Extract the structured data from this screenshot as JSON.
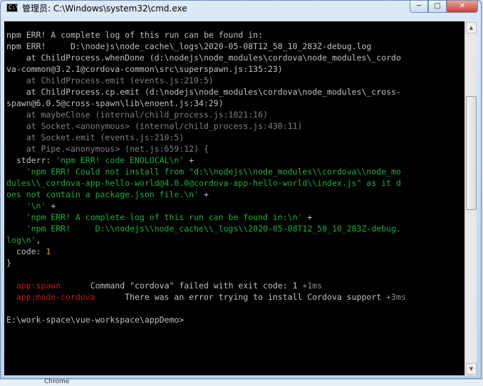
{
  "window": {
    "icon_text": "C:\\",
    "title": "管理员: C:\\Windows\\system32\\cmd.exe",
    "min_label": "─",
    "max_label": "□",
    "close_label": "✕"
  },
  "console": {
    "lines": [
      [
        {
          "t": "npm ERR! A complete log of this run can be found in:"
        }
      ],
      [
        {
          "t": "npm ERR!     D:\\nodejs\\node_cache\\_logs\\2020-05-08T12_58_10_283Z-debug.log"
        }
      ],
      [
        {
          "t": "    at ChildProcess.whenDone (d:\\nodejs\\node_modules\\cordova\\node_modules\\_cordo"
        }
      ],
      [
        {
          "t": "va-common@3.2.1@cordova-common\\src\\superspawn.js:135:23)"
        }
      ],
      [
        {
          "t": "    at ChildProcess.emit (events.js:210:5)",
          "c": "gr"
        }
      ],
      [
        {
          "t": "    at ChildProcess.cp.emit (d:\\nodejs\\node_modules\\cordova\\node_modules\\_cross-"
        }
      ],
      [
        {
          "t": "spawn@6.0.5@cross-spawn\\lib\\enoent.js:34:29)"
        }
      ],
      [
        {
          "t": "    at maybeClose (internal/child_process.js:1021:16)",
          "c": "gr"
        }
      ],
      [
        {
          "t": "    at Socket.<anonymous> (internal/child_process.js:430:11)",
          "c": "gr"
        }
      ],
      [
        {
          "t": "    at Socket.emit (events.js:210:5)",
          "c": "gr"
        }
      ],
      [
        {
          "t": "    at Pipe.<anonymous> (net.js:659:12) {",
          "c": "gr"
        }
      ],
      [
        {
          "t": "  stderr: "
        },
        {
          "t": "'npm ERR! code ENOLOCAL\\n'",
          "c": "g"
        },
        {
          "t": " +"
        }
      ],
      [
        {
          "t": "    'npm ERR! Could not install from \"d:\\\\nodejs\\\\node_modules\\\\cordova\\\\node_mo",
          "c": "g"
        }
      ],
      [
        {
          "t": "dules\\\\_cordova-app-hello-world@4.0.0@cordova-app-hello-world\\\\index.js\" as it d",
          "c": "g"
        }
      ],
      [
        {
          "t": "oes not contain a package.json file.\\n'",
          "c": "g"
        },
        {
          "t": " +"
        }
      ],
      [
        {
          "t": "    "
        },
        {
          "t": "'\\n'",
          "c": "g"
        },
        {
          "t": " +"
        }
      ],
      [
        {
          "t": "    'npm ERR! A complete log of this run can be found in:\\n'",
          "c": "g"
        },
        {
          "t": " +"
        }
      ],
      [
        {
          "t": "    'npm ERR!     D:\\\\nodejs\\\\node_cache\\\\_logs\\\\2020-05-08T12_58_10_283Z-debug.",
          "c": "g"
        }
      ],
      [
        {
          "t": "log\\n'",
          "c": "g"
        },
        {
          "t": ","
        }
      ],
      [
        {
          "t": "  code: "
        },
        {
          "t": "1",
          "c": "o"
        }
      ],
      [
        {
          "t": "}"
        }
      ],
      [
        {
          "t": ""
        }
      ],
      [
        {
          "t": "  app:spawn",
          "c": "r"
        },
        {
          "t": "      Command \"cordova\" failed with exit code: 1 "
        },
        {
          "t": "+1ms",
          "c": "ms"
        }
      ],
      [
        {
          "t": "  app:mode-cordova",
          "c": "r"
        },
        {
          "t": "      There was an error trying to install Cordova support "
        },
        {
          "t": "+3ms",
          "c": "ms"
        }
      ],
      [
        {
          "t": ""
        }
      ],
      [
        {
          "t": "E:\\work-space\\vue-workspace\\appDemo>"
        }
      ]
    ]
  },
  "scrollbar": {
    "up_label": "▲",
    "down_label": "▼"
  },
  "taskbar": {
    "partial_label": "Chrome"
  }
}
